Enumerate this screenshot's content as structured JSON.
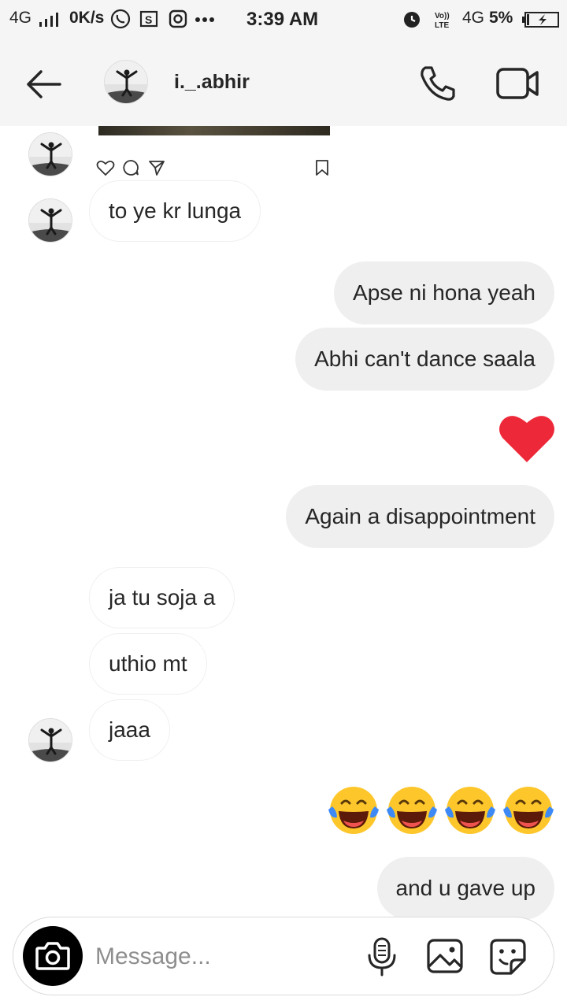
{
  "status_bar": {
    "network_left": "4G",
    "speed": "0K/s",
    "time": "3:39 AM",
    "network_right": "4G",
    "volte": "Vo)) LTE",
    "battery": "5%"
  },
  "header": {
    "username": "i._.abhir",
    "back_icon": "arrow-left-icon",
    "call_icon": "phone-icon",
    "video_icon": "video-camera-icon"
  },
  "messages": [
    {
      "side": "in",
      "text": "to ye kr lunga"
    },
    {
      "side": "out",
      "text": "Apse ni hona yeah"
    },
    {
      "side": "out",
      "text": "Abhi can't dance saala"
    },
    {
      "side": "out",
      "type": "heart"
    },
    {
      "side": "out",
      "text": "Again a disappointment"
    },
    {
      "side": "in",
      "text": "ja tu soja a"
    },
    {
      "side": "in",
      "text": "uthio mt"
    },
    {
      "side": "in",
      "text": "jaaa"
    },
    {
      "side": "out",
      "type": "emoji",
      "text": "😂😂😂😂"
    },
    {
      "side": "out",
      "text": "and u gave up"
    }
  ],
  "composer": {
    "placeholder": "Message...",
    "value": ""
  },
  "colors": {
    "bubble_out": "#efefef",
    "heart": "#ed2939",
    "header_bg": "#f5f5f5"
  }
}
